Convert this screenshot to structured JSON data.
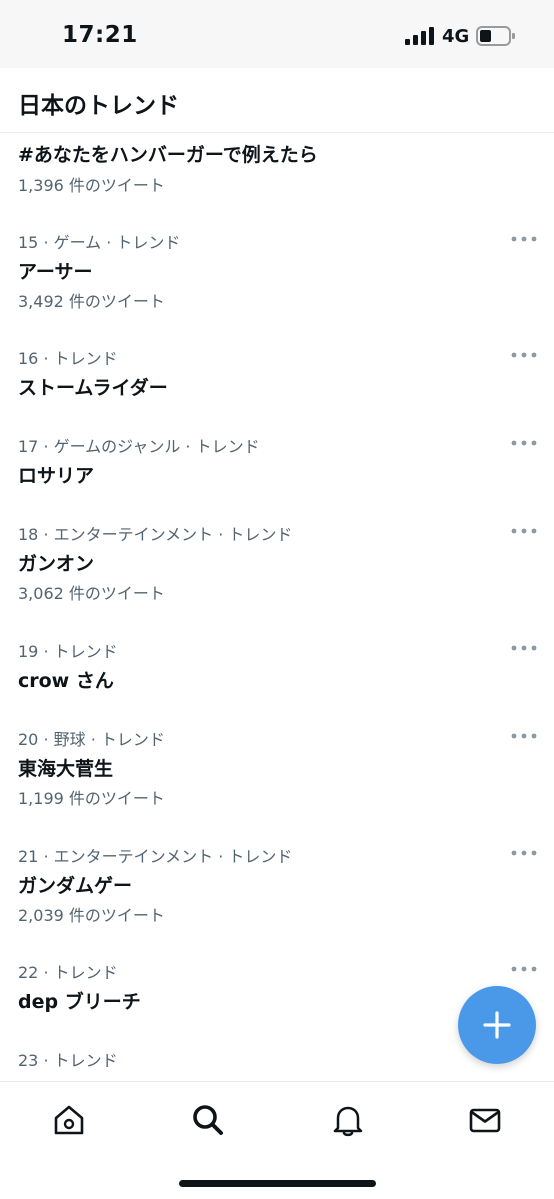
{
  "status_bar": {
    "time": "17:21",
    "network": "4G"
  },
  "header": {
    "title": "日本のトレンド"
  },
  "trends": [
    {
      "meta": "",
      "name": "#あなたをハンバーガーで例えたら",
      "count": "1,396 件のツイート"
    },
    {
      "meta": "15 · ゲーム · トレンド",
      "name": "アーサー",
      "count": "3,492 件のツイート"
    },
    {
      "meta": "16 · トレンド",
      "name": "ストームライダー",
      "count": ""
    },
    {
      "meta": "17 · ゲームのジャンル · トレンド",
      "name": "ロサリア",
      "count": ""
    },
    {
      "meta": "18 · エンターテインメント · トレンド",
      "name": "ガンオン",
      "count": "3,062 件のツイート"
    },
    {
      "meta": "19 · トレンド",
      "name": "crow さん",
      "count": ""
    },
    {
      "meta": "20 · 野球 · トレンド",
      "name": "東海大菅生",
      "count": "1,199 件のツイート"
    },
    {
      "meta": "21 · エンターテインメント · トレンド",
      "name": "ガンダムゲー",
      "count": "2,039 件のツイート"
    },
    {
      "meta": "22 · トレンド",
      "name": "dep ブリーチ",
      "count": ""
    },
    {
      "meta": "23 · トレンド",
      "name": "",
      "count": ""
    }
  ],
  "icons": {
    "more": "more-horizontal-icon",
    "fab": "plus-icon",
    "tabs": [
      "home-icon",
      "search-icon",
      "bell-icon",
      "mail-icon"
    ]
  },
  "colors": {
    "accent": "#4a99e9",
    "text_primary": "#0f1419",
    "text_secondary": "#536471",
    "divider": "#e6ecf0"
  }
}
